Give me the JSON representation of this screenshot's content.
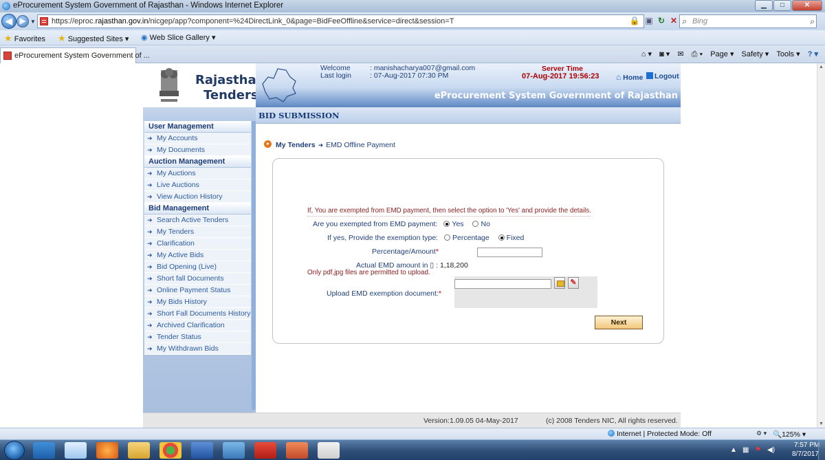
{
  "browser": {
    "window_title": "eProcurement System Government of Rajasthan - Windows Internet Explorer",
    "url_prefix": "https://eproc.",
    "url_domain": "rajasthan.gov.in",
    "url_rest": "/nicgep/app?component=%24DirectLink_0&page=BidFeeOffline&service=direct&session=T",
    "search_placeholder": "Bing",
    "favorites_label": "Favorites",
    "suggested_sites": "Suggested Sites ▾",
    "web_slice_gallery": "Web Slice Gallery ▾",
    "tab_title": "eProcurement System Government of ...",
    "cmd_page": "Page ▾",
    "cmd_safety": "Safety ▾",
    "cmd_tools": "Tools ▾",
    "status_zone": "Internet | Protected Mode: Off",
    "zoom": "125%"
  },
  "header": {
    "brand_line1": "Rajasthan",
    "brand_line2": "Tenders",
    "welcome_label": "Welcome",
    "last_login_label": "Last login",
    "welcome_value": ": manishacharya007@gmail.com",
    "last_login_value": ": 07-Aug-2017 07:30 PM",
    "server_time_label": "Server Time",
    "server_time_value": "07-Aug-2017 19:56:23",
    "home_label": "Home",
    "logout_label": "Logout",
    "portal_title": "eProcurement System Government of Rajasthan"
  },
  "sidebar": {
    "sections": [
      {
        "title": "User Management",
        "items": [
          "My Accounts",
          "My Documents"
        ]
      },
      {
        "title": "Auction Management",
        "items": [
          "My Auctions",
          "Live Auctions",
          "View Auction History"
        ]
      },
      {
        "title": "Bid Management",
        "items": [
          "Search Active Tenders",
          "My Tenders",
          "Clarification",
          "My Active Bids",
          "Bid Opening (Live)",
          "Short fall Documents",
          "Online Payment Status",
          "My Bids History",
          "Short Fall Documents History",
          "Archived Clarification",
          "Tender Status",
          "My Withdrawn Bids"
        ]
      }
    ]
  },
  "main": {
    "section_title": "BID SUBMISSION",
    "breadcrumb_1": "My Tenders",
    "breadcrumb_2": "EMD Offline Payment",
    "emd_note": "If, You are exempted from EMD payment, then select the option to 'Yes' and provide the details.",
    "exempted_label": "Are you exempted from EMD payment:",
    "exempted_options": [
      "Yes",
      "No"
    ],
    "exempted_selected": "Yes",
    "exemption_type_label": "If yes, Provide the exemption type:",
    "exemption_type_options": [
      "Percentage",
      "Fixed"
    ],
    "exemption_type_selected": "Fixed",
    "percentage_amount_label": "Percentage/Amount",
    "percentage_amount_value": "",
    "actual_emd_label": "Actual EMD amount in",
    "currency_symbol": "▯",
    "actual_emd_sep": ":",
    "actual_emd_value": "1,18,200",
    "file_types_note": "Only pdf,jpg files are permitted to upload.",
    "upload_label": "Upload EMD exemption document:",
    "next_button": "Next"
  },
  "footer": {
    "version": "Version:1.09.05 04-May-2017",
    "copyright": "(c) 2008 Tenders NIC, All rights reserved."
  },
  "taskbar": {
    "clock_time": "7:57 PM",
    "clock_date": "8/7/2017"
  }
}
